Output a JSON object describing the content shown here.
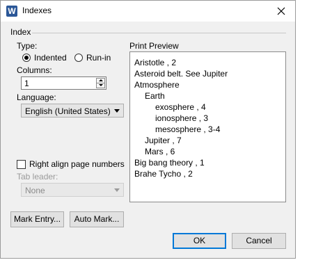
{
  "window": {
    "title": "Indexes",
    "app_icon_letter": "W",
    "close_glyph": "close"
  },
  "index_group": {
    "label": "Index",
    "type_label": "Type:",
    "indented_label": "Indented",
    "runin_label": "Run-in",
    "selected_type": "Indented",
    "columns_label": "Columns:",
    "columns_value": "1",
    "language_label": "Language:",
    "language_value": "English (United States)",
    "right_align_label": "Right align page numbers",
    "right_align_checked": false,
    "tab_leader_label": "Tab leader:",
    "tab_leader_value": "None"
  },
  "preview": {
    "label": "Print Preview",
    "lines": [
      "Aristotle , 2",
      "Asteroid belt. See Jupiter",
      "Atmosphere",
      "Earth",
      "exosphere , 4",
      "ionosphere , 3",
      "mesosphere , 3-4",
      "Jupiter , 7",
      "Mars , 6",
      "Big bang theory , 1",
      "Brahe Tycho , 2"
    ]
  },
  "buttons": {
    "mark_entry": "Mark Entry...",
    "auto_mark": "Auto Mark...",
    "ok": "OK",
    "cancel": "Cancel"
  },
  "colors": {
    "dialog_bg": "#f0f0f0",
    "accent": "#0078d7",
    "app_icon": "#2b5797"
  }
}
